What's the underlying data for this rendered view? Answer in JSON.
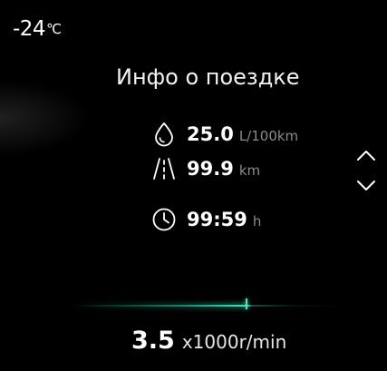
{
  "status": {
    "temperature_value": "-24",
    "temperature_unit": "℃"
  },
  "trip_info": {
    "title": "Инфо о поездке",
    "rows": [
      {
        "icon": "fuel-drop-icon",
        "value": "25.0",
        "unit": "L/100km"
      },
      {
        "icon": "road-icon",
        "value": "99.9",
        "unit": "km"
      },
      {
        "icon": "clock-icon",
        "value": "99:59",
        "unit": "h"
      }
    ]
  },
  "navigation": {
    "up_icon": "chevron-up-icon",
    "down_icon": "chevron-down-icon"
  },
  "rpm": {
    "value": "3.5",
    "unit": "x1000r/min",
    "gauge_fraction": 0.64
  },
  "colors": {
    "background": "#000000",
    "text": "#ffffff",
    "unit_text": "#8a8a8a",
    "accent": "#4fe8c4"
  }
}
